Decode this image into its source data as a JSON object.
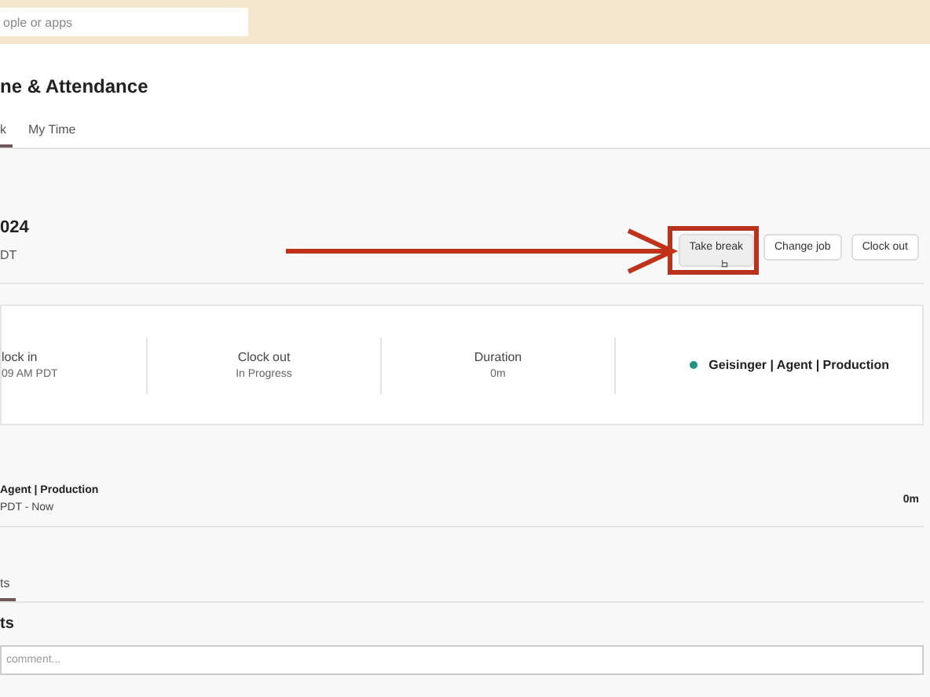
{
  "search": {
    "placeholder": "ople or apps"
  },
  "page_title": "ne & Attendance",
  "tabs": [
    {
      "label": "k",
      "selected": true
    },
    {
      "label": "My Time",
      "selected": false
    }
  ],
  "shift": {
    "date": "024",
    "zone": "DT"
  },
  "buttons": [
    {
      "label": "Take break",
      "highlighted": true
    },
    {
      "label": "Change job",
      "highlighted": false
    },
    {
      "label": "Clock out",
      "highlighted": false
    }
  ],
  "summary": {
    "columns": [
      {
        "label": "lock in",
        "value": "09 AM PDT"
      },
      {
        "label": "Clock out",
        "value": "In Progress"
      },
      {
        "label": "Duration",
        "value": "0m"
      }
    ],
    "job": "Geisinger | Agent | Production"
  },
  "entry": {
    "title": "Agent | Production",
    "time": "PDT - Now",
    "duration": "0m"
  },
  "lower_tabs": [
    {
      "label": "ts",
      "selected": true
    }
  ],
  "comments": {
    "heading": "ts",
    "placeholder": "comment..."
  }
}
